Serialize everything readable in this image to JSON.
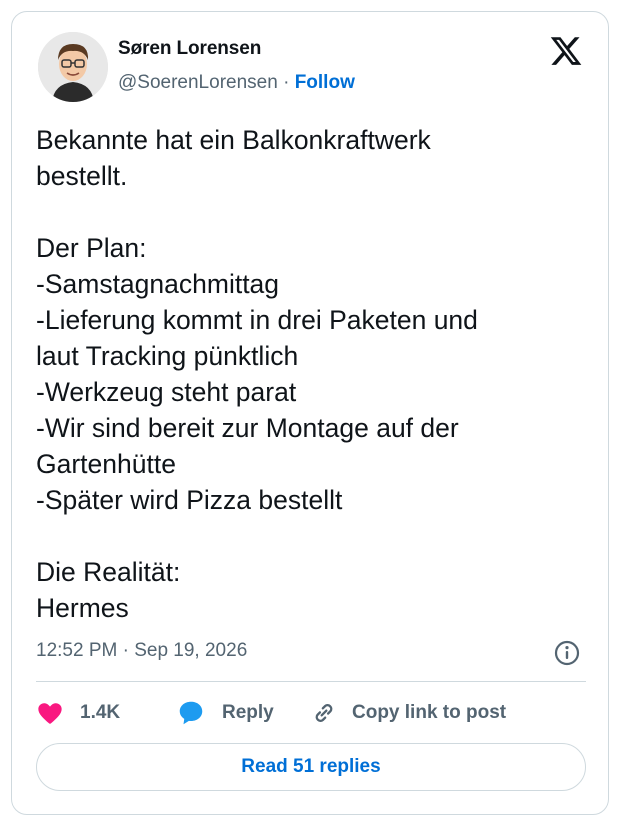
{
  "author": {
    "name": "Søren Lorensen",
    "handle": "@SoerenLorensen",
    "separator": "·",
    "follow_label": "Follow"
  },
  "tweet": {
    "text": "Bekannte hat ein Balkonkraftwerk\nbestellt.\n\nDer Plan:\n-Samstagnachmittag\n-Lieferung kommt in drei Paketen und\nlaut Tracking pünktlich\n-Werkzeug steht parat\n-Wir sind bereit zur Montage auf der\nGartenhütte\n-Später wird Pizza bestellt\n\nDie Realität:\nHermes",
    "timestamp": "12:52 PM · Sep 19, 2026"
  },
  "actions": {
    "like_count": "1.4K",
    "reply_label": "Reply",
    "copy_label": "Copy link to post"
  },
  "read_replies_label": "Read 51 replies",
  "colors": {
    "accent": "#006fd6",
    "like": "#f91880",
    "reply_icon": "#1d9bf0",
    "muted": "#536471",
    "border": "#cfd9de"
  },
  "icons": [
    "x-logo-icon",
    "info-icon",
    "heart-icon",
    "reply-bubble-icon",
    "link-icon"
  ]
}
